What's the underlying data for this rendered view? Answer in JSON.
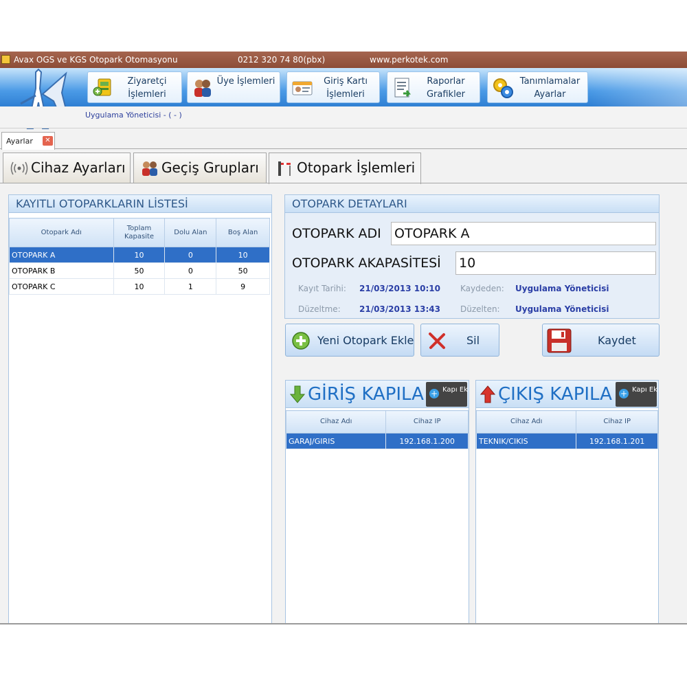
{
  "titlebar": {
    "app_name": "Avax OGS ve KGS Otopark Otomasyonu",
    "phone": "0212 320 74 80(pbx)",
    "website": "www.perkotek.com"
  },
  "ribbon": {
    "buttons": [
      {
        "label": "Ziyaretçi İşlemleri",
        "icon": "visitor-icon"
      },
      {
        "label": "Üye İşlemleri",
        "icon": "members-icon"
      },
      {
        "label": "Giriş Kartı İşlemleri",
        "icon": "id-card-icon"
      },
      {
        "label": "Raporlar Grafikler",
        "icon": "report-icon"
      },
      {
        "label": "Tanımlamalar Ayarlar",
        "icon": "gears-icon"
      }
    ]
  },
  "user": {
    "label": "Uygulama Yöneticisi - ( - )"
  },
  "doc_tab": {
    "label": "Ayarlar"
  },
  "tabs": [
    {
      "label": "Cihaz Ayarları",
      "icon": "antenna-icon"
    },
    {
      "label": "Geçiş Grupları",
      "icon": "group-icon"
    },
    {
      "label": "Otopark İşlemleri",
      "icon": "barrier-icon"
    }
  ],
  "parking_list": {
    "title": "KAYITLI OTOPARKLARIN LİSTESİ",
    "columns": [
      "Otopark Adı",
      "Toplam Kapasite",
      "Dolu Alan",
      "Boş Alan"
    ],
    "rows": [
      [
        "OTOPARK A",
        "10",
        "0",
        "10"
      ],
      [
        "OTOPARK B",
        "50",
        "0",
        "50"
      ],
      [
        "OTOPARK C",
        "10",
        "1",
        "9"
      ]
    ],
    "selected_row": 0
  },
  "details": {
    "title": "OTOPARK DETAYLARI",
    "name_label": "OTOPARK ADI",
    "name_value": "OTOPARK A",
    "capacity_label": "OTOPARK AKAPASİTESİ",
    "capacity_value": "10",
    "created_label": "Kayıt Tarihi:",
    "created_value": "21/03/2013 10:10",
    "created_by_label": "Kaydeden:",
    "created_by_value": "Uygulama Yöneticisi",
    "edited_label": "Düzeltme:",
    "edited_value": "21/03/2013 13:43",
    "edited_by_label": "Düzelten:",
    "edited_by_value": "Uygulama Yöneticisi"
  },
  "actions": {
    "new_label": "Yeni Otopark Ekle",
    "delete_label": "Sil",
    "save_label": "Kaydet"
  },
  "entry_gates": {
    "title": "GİRİŞ KAPILA",
    "add_label": "Kapı Ekle",
    "columns": [
      "Cihaz Adı",
      "Cihaz IP"
    ],
    "rows": [
      [
        "GARAJ/GIRIS",
        "192.168.1.200"
      ]
    ]
  },
  "exit_gates": {
    "title": "ÇIKIŞ KAPILA",
    "add_label": "Kapı Ekle",
    "columns": [
      "Cihaz Adı",
      "Cihaz IP"
    ],
    "rows": [
      [
        "TEKNIK/CIKIS",
        "192.168.1.201"
      ]
    ]
  },
  "colors": {
    "accent": "#2f6fc7",
    "titlebar": "#8d4c37",
    "panel_header": "#2e5889"
  }
}
